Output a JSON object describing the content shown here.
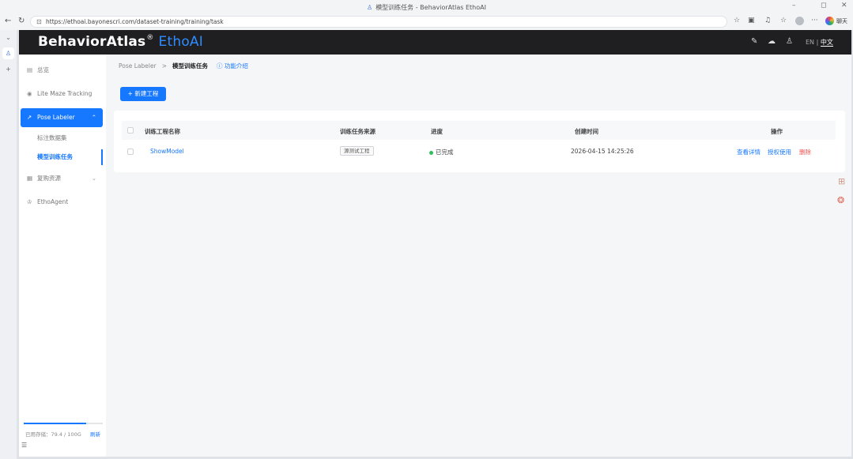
{
  "browser": {
    "tab_title": "模型训练任务 - BehaviorAtlas EthoAI",
    "url": "https://ethoai.bayonescri.com/dataset-training/training/task",
    "copilot_label": "聊天"
  },
  "header": {
    "logo_primary": "BehaviorAtlas",
    "logo_mark": "®",
    "logo_secondary": "EthoAI",
    "lang_en": "EN",
    "lang_sep": "|",
    "lang_zh": "中文"
  },
  "sidebar": {
    "overview": "总览",
    "lite_maze": "Lite Maze Tracking",
    "pose_labeler": "Pose Labeler",
    "sub_dataset": "标注数据集",
    "sub_training": "模型训练任务",
    "purchase": "复购资源",
    "ethoagent": "EthoAgent",
    "storage_label": "已用存储：79.4 / 100G",
    "storage_refresh": "刷新",
    "storage_fraction": 0.79
  },
  "breadcrumb": {
    "parent": "Pose Labeler",
    "separator": ">",
    "current": "模型训练任务",
    "help": "功能介绍"
  },
  "toolbar": {
    "new_button": "+ 新建工程"
  },
  "table": {
    "columns": {
      "name": "训练工程名称",
      "source": "训练任务来源",
      "progress": "进度",
      "created": "创建时间",
      "actions": "操作"
    },
    "rows": [
      {
        "name": "ShowModel",
        "source": "源测试工程",
        "status": "已完成",
        "created": "2026-04-15 14:25:26",
        "action_view": "查看详情",
        "action_auth": "授权使用",
        "action_delete": "删除"
      }
    ]
  },
  "colors": {
    "brand": "#1677ff",
    "header_bg": "#1f1f21",
    "success": "#2fbf5a",
    "danger": "#ef5350"
  },
  "icons": [
    "back-icon",
    "refresh-icon",
    "lock-icon",
    "star-icon",
    "reader-icon",
    "bell-icon",
    "favorites-icon",
    "profile-icon",
    "more-icon",
    "copilot-icon",
    "edit-icon",
    "cloud-icon",
    "user-icon",
    "dashboard-icon",
    "eye-icon",
    "chart-icon",
    "database-icon",
    "robot-icon",
    "float-panel-icon",
    "float-avatar-icon"
  ]
}
